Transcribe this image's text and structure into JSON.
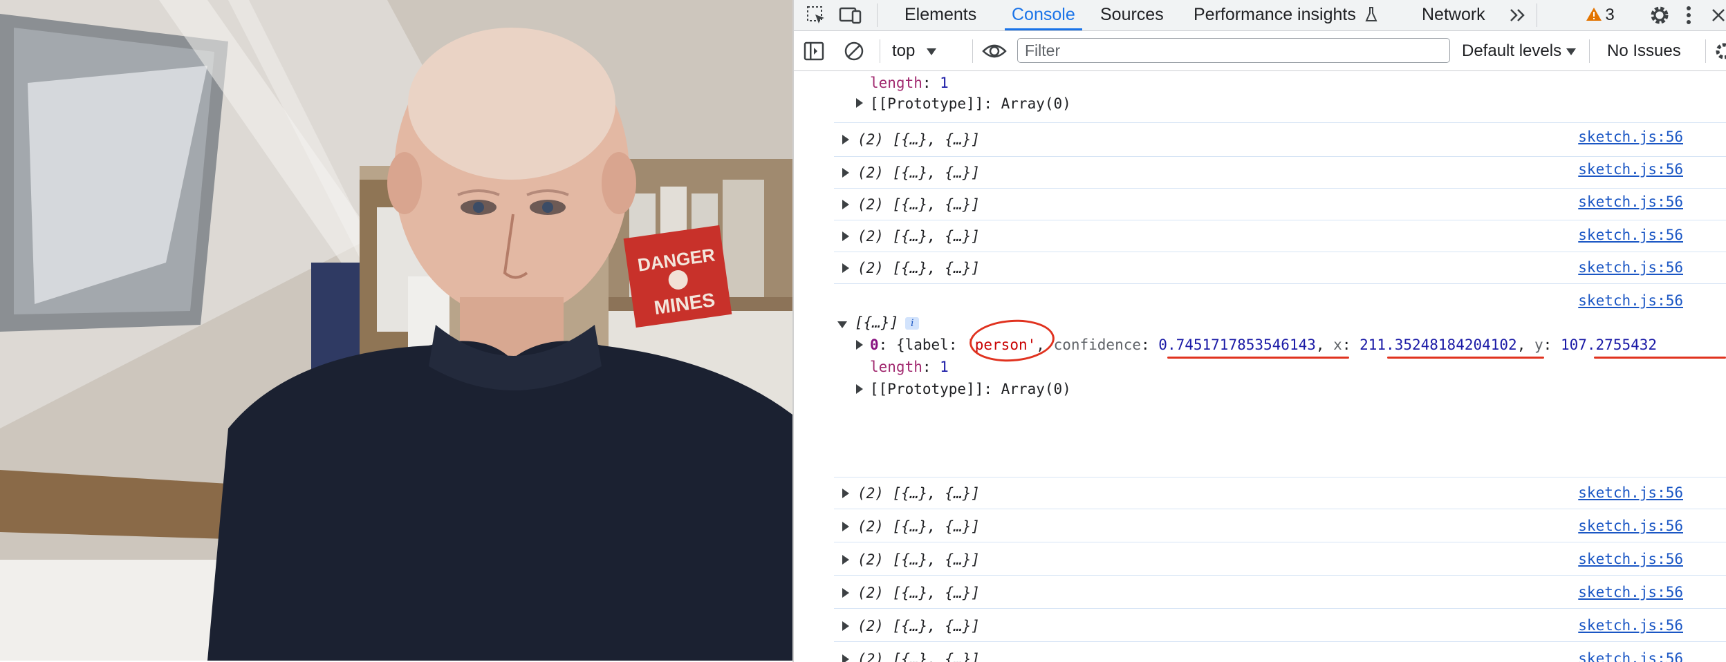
{
  "devtools": {
    "tabs": [
      {
        "label": "Elements"
      },
      {
        "label": "Console"
      },
      {
        "label": "Sources"
      },
      {
        "label": "Performance insights"
      },
      {
        "label": "Network"
      }
    ],
    "active_tab": "Console",
    "warnings_count": "3",
    "toolbar": {
      "context": "top",
      "filter_placeholder": "Filter",
      "levels": "Default levels",
      "issues": "No Issues"
    },
    "console": {
      "top_length_key": "length",
      "top_length_value": "1",
      "top_proto": "[[Prototype]]: Array(0)",
      "collapsed_text": "(2) [{…}, {…}]",
      "source_link": "sketch.js:56",
      "expanded": {
        "header": "[{…}]",
        "info_badge": "i",
        "item_index": "0",
        "label_key": "label",
        "label_value": "'person'",
        "confidence_key": "confidence",
        "confidence_value": "0.7451717853546143",
        "x_key": "x",
        "x_value": "211.35248184204102",
        "y_key": "y",
        "y_value": "107.2755432",
        "length_key": "length",
        "length_value": "1",
        "proto": "[[Prototype]]: Array(0)"
      }
    }
  },
  "photo": {
    "poster_text_line1": "DANGER",
    "poster_text_line2": "MINES"
  }
}
